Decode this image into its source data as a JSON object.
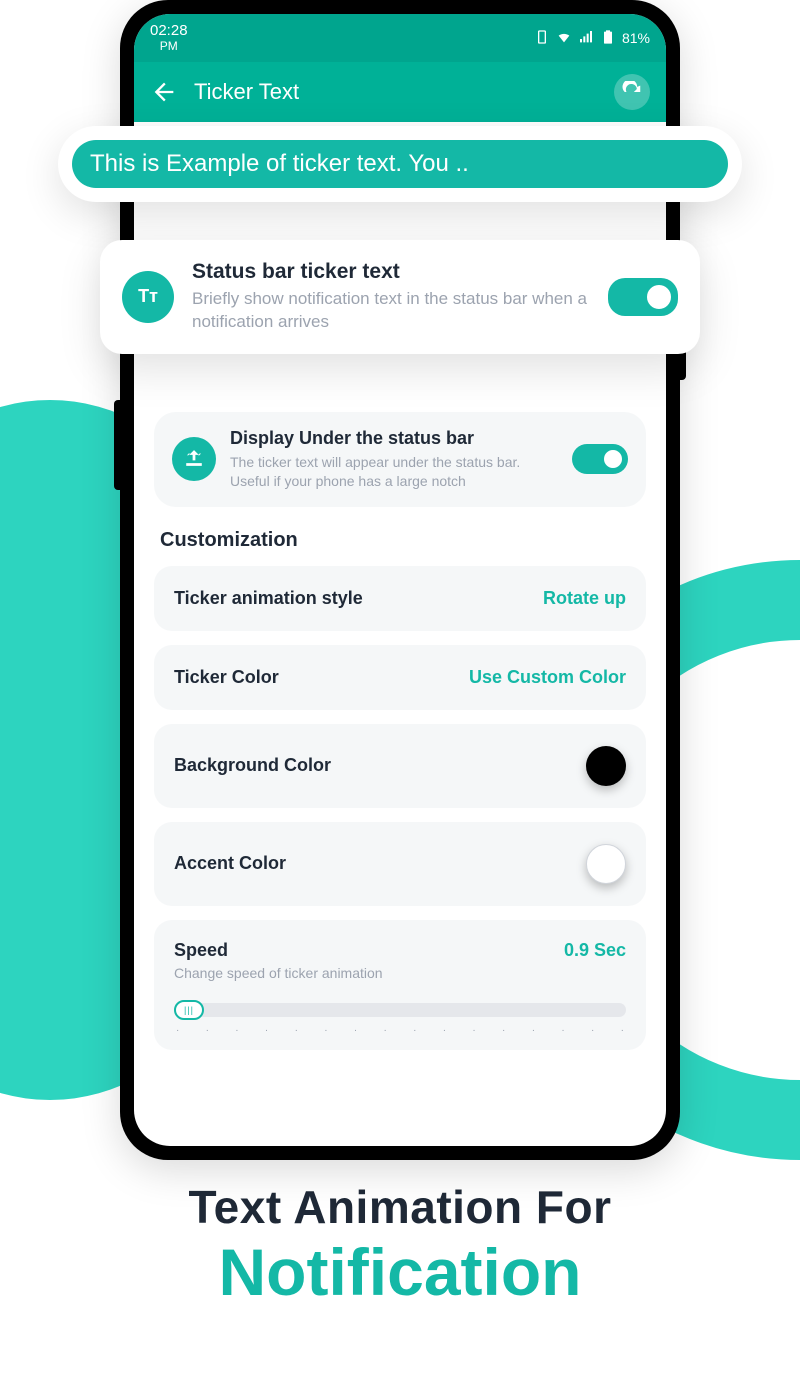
{
  "status": {
    "time": "02:28",
    "ampm": "PM",
    "battery": "81%"
  },
  "header": {
    "title": "Ticker Text"
  },
  "example": {
    "text": "This is Example of ticker text. You .."
  },
  "card1": {
    "title": "Status bar ticker text",
    "desc": "Briefly show notification text in the status bar when a notification arrives",
    "iconLabel": "Tᴛ"
  },
  "card2": {
    "title": "Display Under the status bar",
    "desc": "The ticker text will appear under the status bar. Useful if your phone has a large notch"
  },
  "customization": {
    "heading": "Customization",
    "rows": {
      "animStyle": {
        "label": "Ticker animation style",
        "value": "Rotate up"
      },
      "tickerColor": {
        "label": "Ticker Color",
        "value": "Use Custom Color"
      },
      "bgColor": {
        "label": "Background Color",
        "swatch": "#000000"
      },
      "accentColor": {
        "label": "Accent Color",
        "swatch": "#ffffff"
      },
      "speed": {
        "label": "Speed",
        "value": "0.9 Sec",
        "sub": "Change speed of ticker animation"
      }
    }
  },
  "marketing": {
    "line1": "Text Animation For",
    "line2": "Notification"
  }
}
